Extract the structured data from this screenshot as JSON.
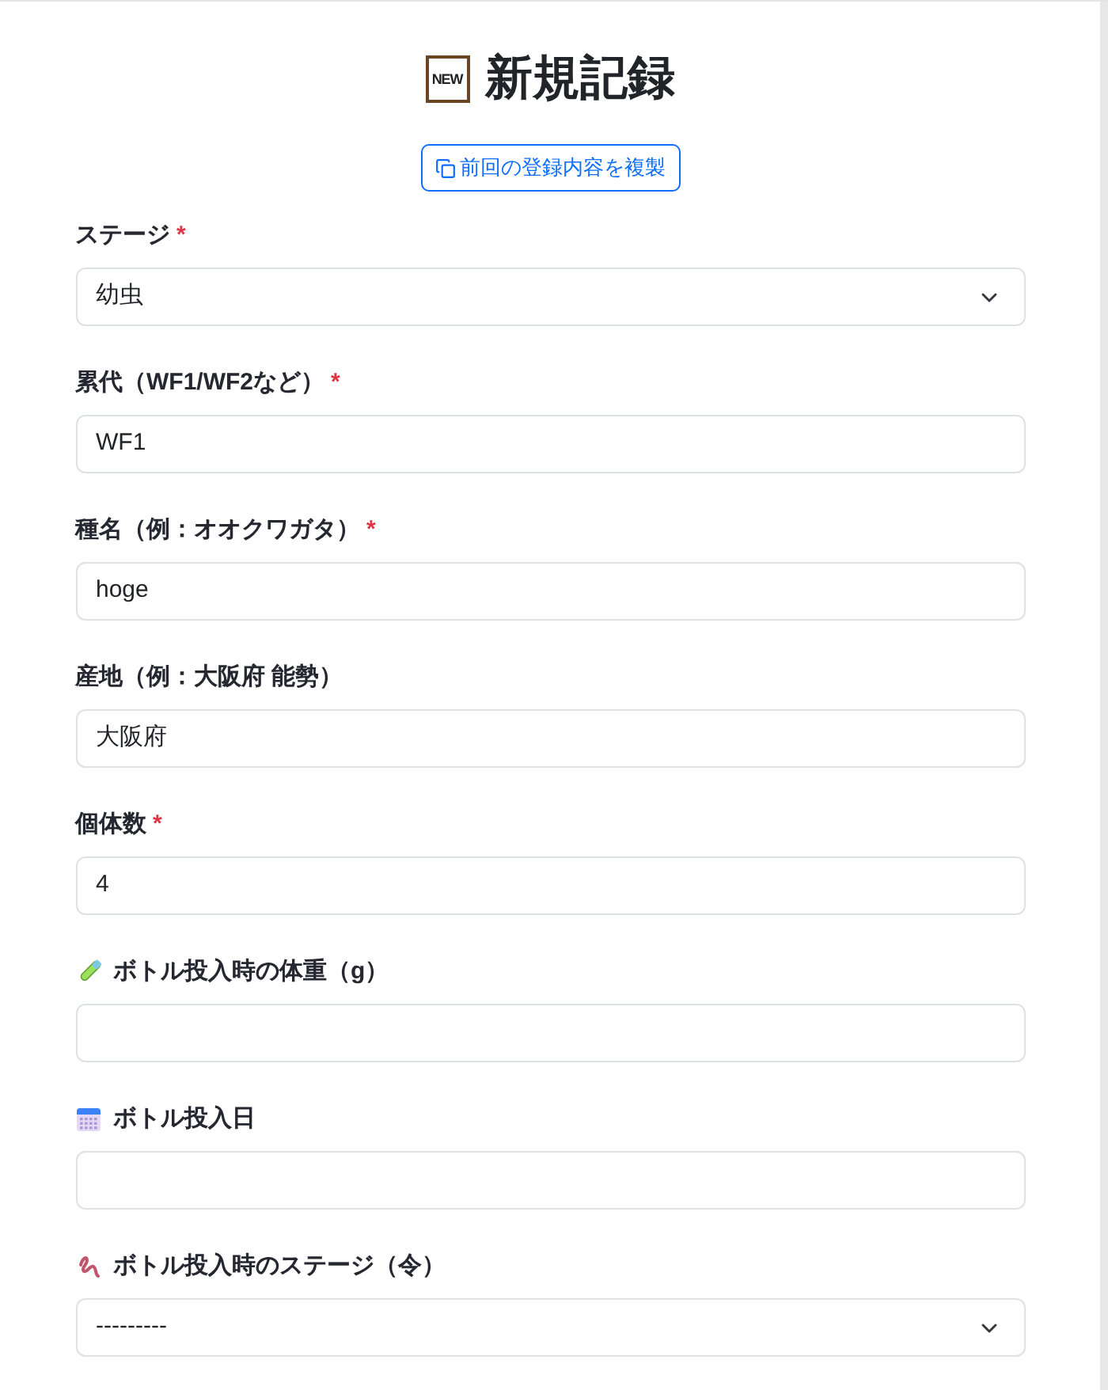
{
  "header": {
    "badge": "NEW",
    "title": "新規記録",
    "copy_button": {
      "label": "前回の登録内容を複製"
    }
  },
  "fields": [
    {
      "kind": "select",
      "label": "ステージ",
      "required_mark": "*",
      "value": "幼虫"
    },
    {
      "kind": "text",
      "label": "累代（WF1/WF2など）",
      "required_mark": "*",
      "value": "WF1"
    },
    {
      "kind": "text",
      "label": "種名（例：オオクワガタ）",
      "required_mark": "*",
      "value": "hoge"
    },
    {
      "kind": "text",
      "label": "産地（例：大阪府 能勢）",
      "value": "大阪府"
    },
    {
      "kind": "text",
      "label": "個体数",
      "required_mark": "*",
      "value": "4"
    },
    {
      "kind": "text",
      "label": "ボトル投入時の体重（g）"
    },
    {
      "kind": "text",
      "label": "ボトル投入日"
    },
    {
      "kind": "select",
      "label": "ボトル投入時のステージ（令）",
      "value": "---------"
    }
  ]
}
